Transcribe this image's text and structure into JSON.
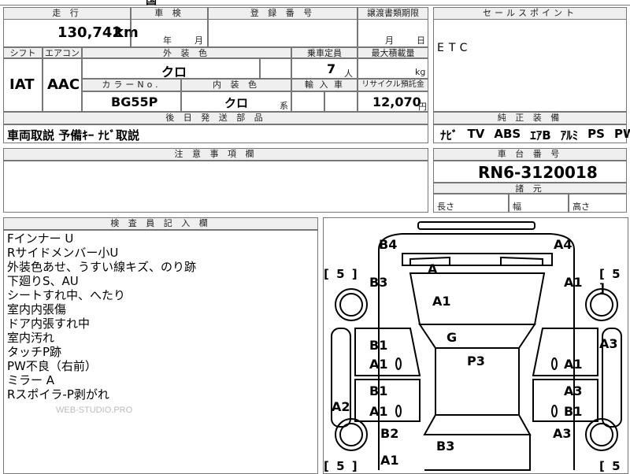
{
  "top_fragment": "国",
  "header_labels": {
    "mileage": "走 行",
    "shaken": "車 検",
    "registration": "登 録 番 号",
    "transfer_docs": "譲渡書類期限",
    "sales_point": "セールスポイント",
    "shift": "シフト",
    "aircon": "エアコン",
    "exterior_color": "外 装 色",
    "capacity": "乗車定員",
    "max_load": "最大積載量",
    "color_no": "カラーNo.",
    "interior_color": "内 装 色",
    "import": "輸 入 車",
    "recycle": "リサイクル預託金",
    "later_parts": "後 日 発 送 部 品",
    "equipment": "純 正 装 備",
    "caution": "注 意 事 項 欄",
    "chassis_no": "車 台 番 号",
    "dimensions": "諸 元",
    "inspector": "検 査 員 記 入 欄"
  },
  "vehicle": {
    "mileage_value": "130,742",
    "mileage_unit": "km",
    "shaken_year_unit": "年",
    "shaken_month_unit": "月",
    "transfer_month_unit": "月",
    "transfer_day_unit": "日",
    "shift": "IAT",
    "aircon": "AAC",
    "exterior_color": "クロ",
    "capacity_value": "7",
    "capacity_unit": "人",
    "max_load_unit": "kg",
    "color_no": "BG55P",
    "interior_color": "クロ",
    "interior_suffix": "系",
    "recycle_value": "12,070",
    "recycle_unit": "円",
    "sales_point": "ETC",
    "later_parts": "車両取説 予備ｷｰ ﾅﾋﾞ取説",
    "equipment": [
      "ﾅﾋﾞ",
      "TV",
      "ABS",
      "ｴｱB",
      "ｱﾙﾐ",
      "PS",
      "PW"
    ],
    "chassis_no": "RN6-3120018",
    "dim_length": "長さ",
    "dim_width": "幅",
    "dim_height": "高さ"
  },
  "inspector_notes": [
    "Fインナー U",
    "Rサイドメンバー小U",
    "外装色あせ、うすい線キズ、のり跡",
    "下廻りS、AU",
    "シートすれ中、へたり",
    "室内内張傷",
    "ドア内張すれ中",
    "室内汚れ",
    "タッチP跡",
    "PW不良（右前）",
    "ミラー A",
    "Rスポイラ-P剥がれ"
  ],
  "watermark": "WEB-STUDIO.PRO",
  "diagram_labels": {
    "b4": "B4",
    "a4": "A4",
    "a_front": "A",
    "tire_fl": "5",
    "tire_fr": "5",
    "tire_rl": "5",
    "tire_rr": "5",
    "b3_top_left": "B3",
    "a1_top_right": "A1",
    "a1_hood": "A1",
    "g_windshield": "G",
    "a3_right_fender": "A3",
    "b1_l_front_door": "B1",
    "a1_l_front_door": "A1",
    "p3_roof": "P3",
    "a1_r_front_door": "A1",
    "b1_l_rear_door": "B1",
    "a1_l_rear_door": "A1",
    "a3_r_rear_door": "A3",
    "b1_r_rear_door": "B1",
    "a2_left_quarter": "A2",
    "b2_left_rear": "B2",
    "b3_trunk": "B3",
    "a3_right_rear": "A3",
    "a1_bottom_left": "A1"
  }
}
